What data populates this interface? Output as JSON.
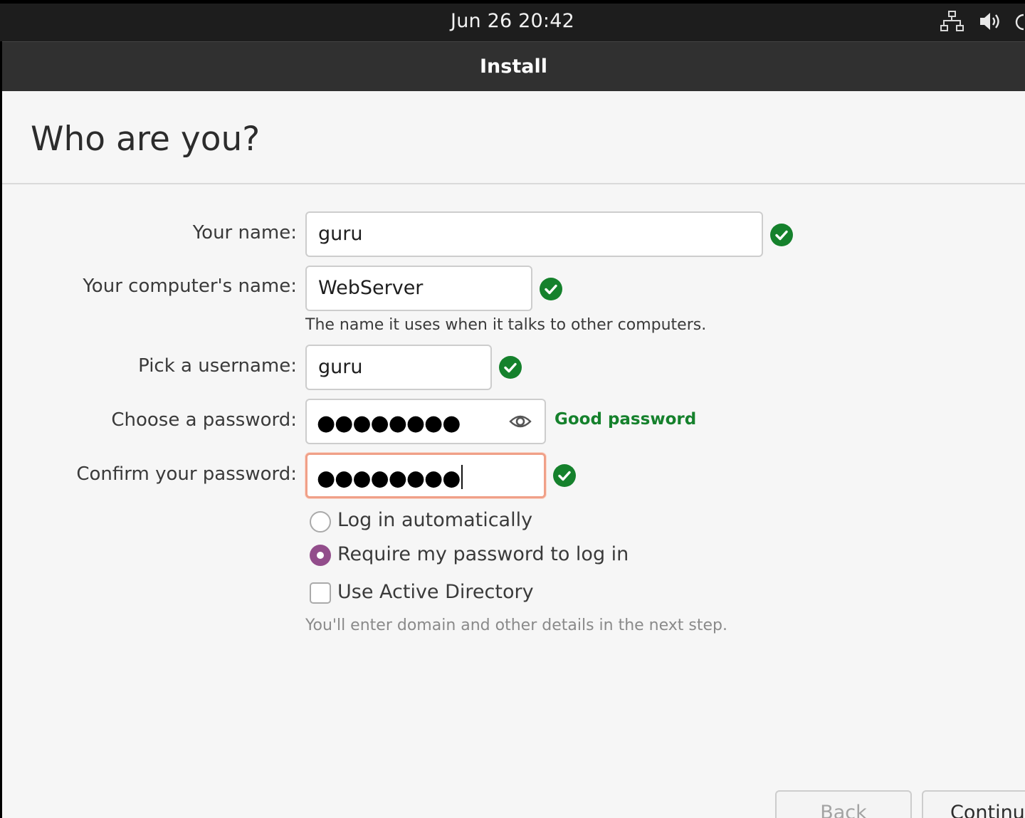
{
  "topbar": {
    "clock": "Jun 26  20:42",
    "icons": [
      "network-icon",
      "volume-icon",
      "power-icon"
    ]
  },
  "window": {
    "title": "Install"
  },
  "page": {
    "title": "Who are you?"
  },
  "form": {
    "your_name": {
      "label": "Your name:",
      "value": "guru",
      "valid": true
    },
    "computer_name": {
      "label": "Your computer's name:",
      "value": "WebServer",
      "valid": true,
      "hint": "The name it uses when it talks to other computers."
    },
    "username": {
      "label": "Pick a username:",
      "value": "guru",
      "valid": true
    },
    "password": {
      "label": "Choose a password:",
      "masked": "●●●●●●●●",
      "strength": "Good password",
      "reveal_icon": "eye-icon"
    },
    "confirm_password": {
      "label": "Confirm your password:",
      "masked": "●●●●●●●●",
      "valid": true
    }
  },
  "login_options": {
    "auto_login": {
      "label": "Log in automatically",
      "selected": false
    },
    "require_password": {
      "label": "Require my password to log in",
      "selected": true
    }
  },
  "active_directory": {
    "label": "Use Active Directory",
    "checked": false,
    "hint": "You'll enter domain and other details in the next step."
  },
  "buttons": {
    "back": "Back",
    "continue": "Continue"
  },
  "colors": {
    "valid_green": "#15812c",
    "radio_purple": "#924d8b",
    "focus_orange": "#f0a088",
    "headerbar": "#303030"
  }
}
